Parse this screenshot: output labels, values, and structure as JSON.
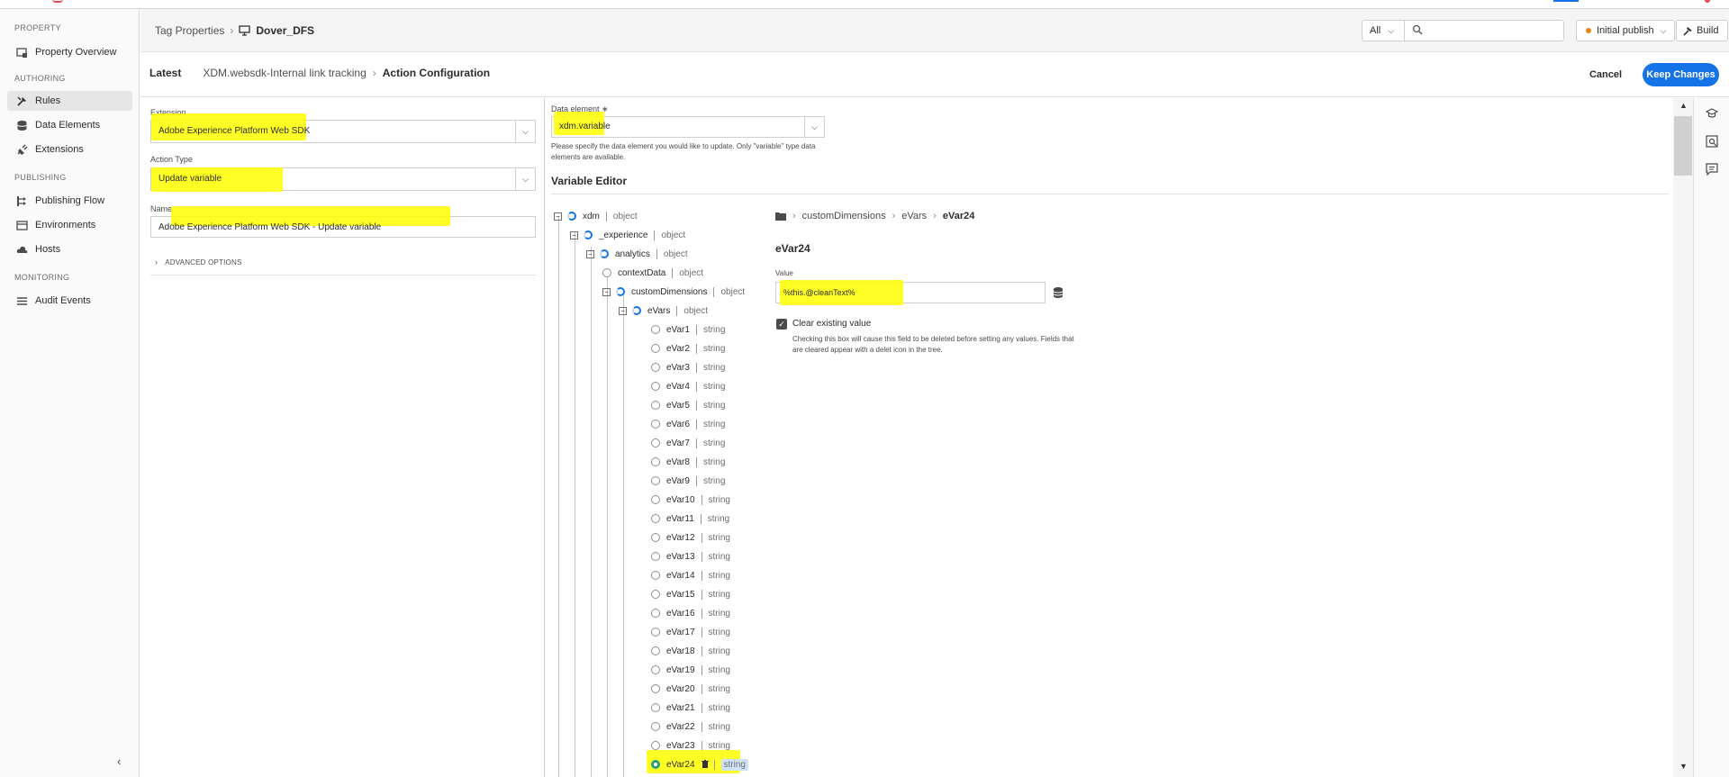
{
  "sidebar": {
    "sections": {
      "property": "PROPERTY",
      "authoring": "AUTHORING",
      "publishing": "PUBLISHING",
      "monitoring": "MONITORING"
    },
    "items": {
      "property_overview": "Property Overview",
      "rules": "Rules",
      "data_elements": "Data Elements",
      "extensions": "Extensions",
      "publishing_flow": "Publishing Flow",
      "environments": "Environments",
      "hosts": "Hosts",
      "audit_events": "Audit Events"
    },
    "active": "rules"
  },
  "header": {
    "breadcrumb_root": "Tag Properties",
    "property_name": "Dover_DFS",
    "filter_value": "All",
    "search_placeholder": "",
    "publish_label": "Initial publish",
    "build_label": "Build"
  },
  "subheader": {
    "latest": "Latest",
    "rule_name": "XDM.websdk-Internal link tracking",
    "current": "Action Configuration",
    "cancel": "Cancel",
    "keep": "Keep Changes"
  },
  "left": {
    "extension_label": "Extension",
    "extension_value": "Adobe Experience Platform Web SDK",
    "action_type_label": "Action Type",
    "action_type_value": "Update variable",
    "name_label": "Name",
    "name_value": "Adobe Experience Platform Web SDK - Update variable",
    "advanced_options": "ADVANCED OPTIONS"
  },
  "right": {
    "data_element_label": "Data element ∗",
    "data_element_value": "xdm.variable",
    "data_element_help": "Please specify the data element you would like to update. Only \"variable\" type data elements are available.",
    "variable_editor_title": "Variable Editor",
    "tree": [
      {
        "name": "xdm",
        "type": "object"
      },
      {
        "name": "_experience",
        "type": "object"
      },
      {
        "name": "analytics",
        "type": "object"
      },
      {
        "name": "contextData",
        "type": "object"
      },
      {
        "name": "customDimensions",
        "type": "object"
      },
      {
        "name": "eVars",
        "type": "object"
      },
      {
        "name": "eVar1",
        "type": "string"
      },
      {
        "name": "eVar2",
        "type": "string"
      },
      {
        "name": "eVar3",
        "type": "string"
      },
      {
        "name": "eVar4",
        "type": "string"
      },
      {
        "name": "eVar5",
        "type": "string"
      },
      {
        "name": "eVar6",
        "type": "string"
      },
      {
        "name": "eVar7",
        "type": "string"
      },
      {
        "name": "eVar8",
        "type": "string"
      },
      {
        "name": "eVar9",
        "type": "string"
      },
      {
        "name": "eVar10",
        "type": "string"
      },
      {
        "name": "eVar11",
        "type": "string"
      },
      {
        "name": "eVar12",
        "type": "string"
      },
      {
        "name": "eVar13",
        "type": "string"
      },
      {
        "name": "eVar14",
        "type": "string"
      },
      {
        "name": "eVar15",
        "type": "string"
      },
      {
        "name": "eVar16",
        "type": "string"
      },
      {
        "name": "eVar17",
        "type": "string"
      },
      {
        "name": "eVar18",
        "type": "string"
      },
      {
        "name": "eVar19",
        "type": "string"
      },
      {
        "name": "eVar20",
        "type": "string"
      },
      {
        "name": "eVar21",
        "type": "string"
      },
      {
        "name": "eVar22",
        "type": "string"
      },
      {
        "name": "eVar23",
        "type": "string"
      },
      {
        "name": "eVar24",
        "type": "string"
      }
    ],
    "path": [
      "customDimensions",
      "eVars",
      "eVar24"
    ],
    "field_title": "eVar24",
    "value_label": "Value",
    "value": "%this.@cleanText%",
    "clear_label": "Clear existing value",
    "clear_checked": true,
    "clear_help": "Checking this box will cause this field to be deleted before setting any values. Fields that are cleared appear with a delet icon in the tree."
  },
  "colors": {
    "accent": "#1473e6",
    "highlight": "#ffff00",
    "publish_dot": "#e68619",
    "selected_radio": "#2d9d78"
  }
}
